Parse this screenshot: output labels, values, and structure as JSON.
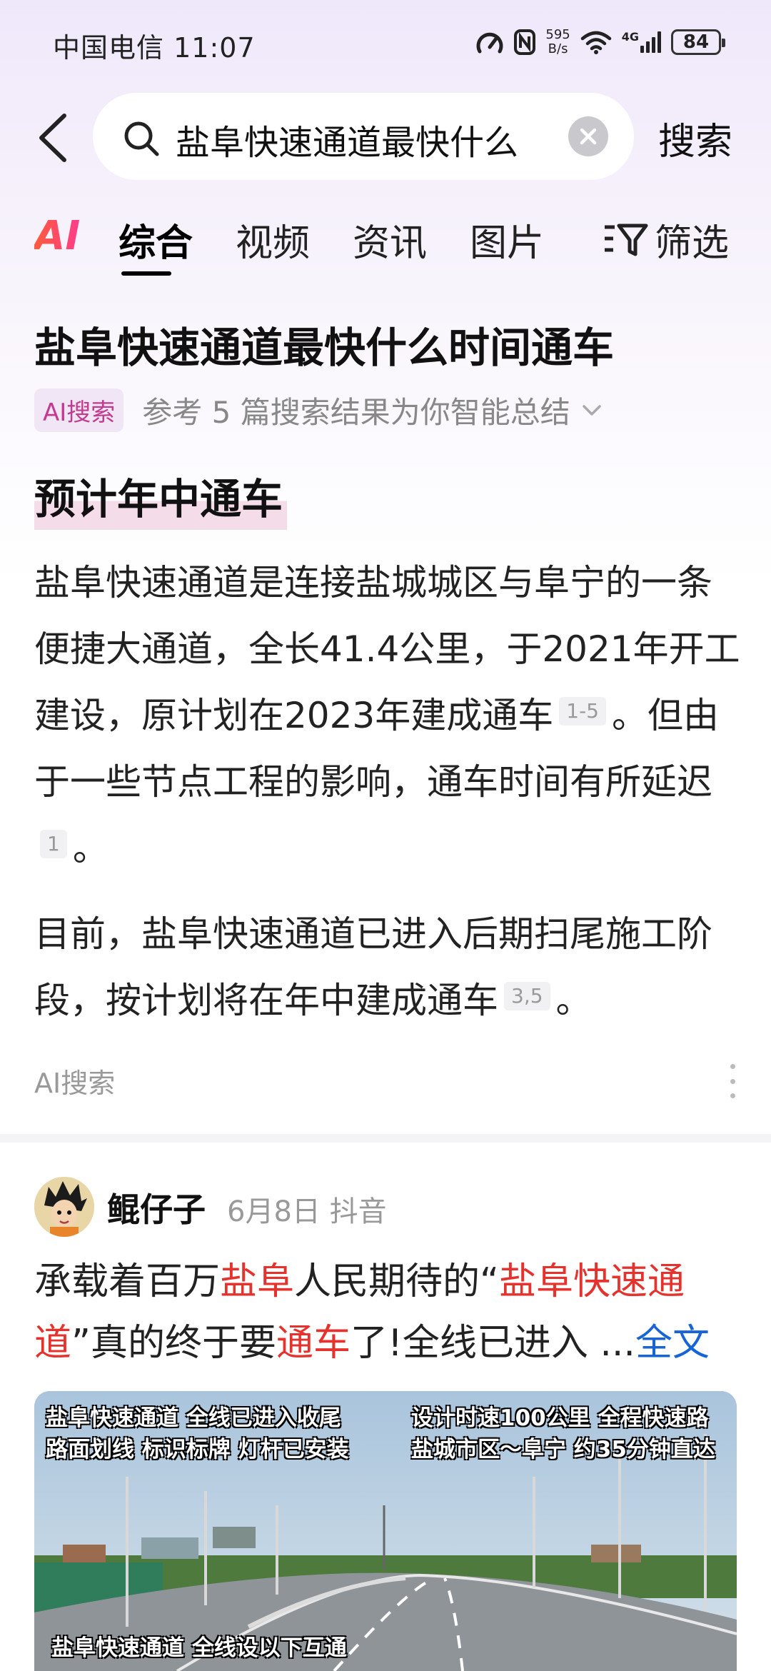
{
  "status_bar": {
    "carrier": "中国电信",
    "time": "11:07",
    "net_speed_value": "595",
    "net_speed_unit": "B/s",
    "network_type": "4G",
    "battery": "84"
  },
  "search": {
    "query": "盐阜快速通道最快什么",
    "button_label": "搜索"
  },
  "tabs": {
    "ai_logo": "AI",
    "items": [
      {
        "label": "综合",
        "active": true
      },
      {
        "label": "视频",
        "active": false
      },
      {
        "label": "资讯",
        "active": false
      },
      {
        "label": "图片",
        "active": false
      }
    ],
    "filter_label": "筛选"
  },
  "ai_answer": {
    "question": "盐阜快速通道最快什么时间通车",
    "badge": "AI搜索",
    "reference_text": "参考 5 篇搜索结果为你智能总结",
    "headline": "预计年中通车",
    "para1_a": "盐阜快速通道是连接盐城城区与阜宁的一条便捷大通道，全长41.4公里，于2021年开工建设，原计划在2023年建成通车",
    "para1_cite1": "1-5",
    "para1_b": "。但由于一些节点工程的影响，通车时间有所延迟",
    "para1_cite2": "1",
    "para1_c": "。",
    "para2_a": "目前，盐阜快速通道已进入后期扫尾施工阶段，按计划将在年中建成通车",
    "para2_cite": "3,5",
    "para2_b": "。",
    "footer": "AI搜索"
  },
  "post": {
    "author": "鲲仔子",
    "date": "6月8日",
    "source": "抖音",
    "text_parts": [
      "承载着百万",
      "盐阜",
      "人民期待的“",
      "盐阜快速通道",
      "”真的终于要",
      "通车",
      "了!全线已进入 ..."
    ],
    "more_label": "全文",
    "image_captions": {
      "left_line1": "盐阜快速通道 全线已进入收尾",
      "left_line2": "路面划线 标识标牌 灯杆已安装",
      "right_line1": "设计时速100公里 全程快速路",
      "right_line2": "盐城市区～阜宁 约35分钟直达",
      "bottom": "盐阜快速通道 全线设以下互通"
    }
  }
}
